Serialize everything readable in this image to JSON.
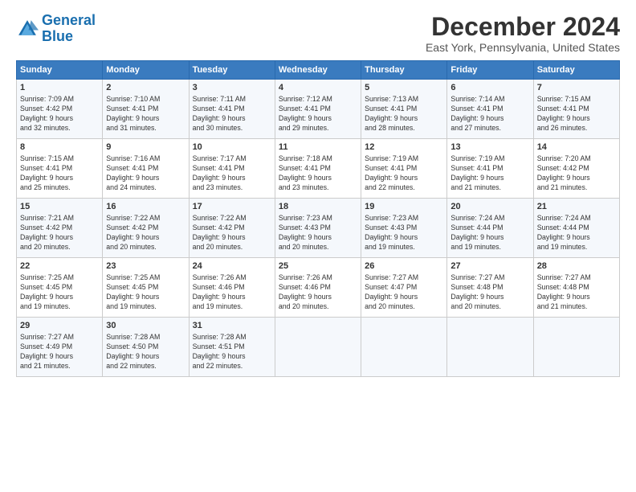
{
  "header": {
    "logo_line1": "General",
    "logo_line2": "Blue",
    "main_title": "December 2024",
    "subtitle": "East York, Pennsylvania, United States"
  },
  "columns": [
    "Sunday",
    "Monday",
    "Tuesday",
    "Wednesday",
    "Thursday",
    "Friday",
    "Saturday"
  ],
  "weeks": [
    [
      {
        "day": "1",
        "info": "Sunrise: 7:09 AM\nSunset: 4:42 PM\nDaylight: 9 hours\nand 32 minutes."
      },
      {
        "day": "2",
        "info": "Sunrise: 7:10 AM\nSunset: 4:41 PM\nDaylight: 9 hours\nand 31 minutes."
      },
      {
        "day": "3",
        "info": "Sunrise: 7:11 AM\nSunset: 4:41 PM\nDaylight: 9 hours\nand 30 minutes."
      },
      {
        "day": "4",
        "info": "Sunrise: 7:12 AM\nSunset: 4:41 PM\nDaylight: 9 hours\nand 29 minutes."
      },
      {
        "day": "5",
        "info": "Sunrise: 7:13 AM\nSunset: 4:41 PM\nDaylight: 9 hours\nand 28 minutes."
      },
      {
        "day": "6",
        "info": "Sunrise: 7:14 AM\nSunset: 4:41 PM\nDaylight: 9 hours\nand 27 minutes."
      },
      {
        "day": "7",
        "info": "Sunrise: 7:15 AM\nSunset: 4:41 PM\nDaylight: 9 hours\nand 26 minutes."
      }
    ],
    [
      {
        "day": "8",
        "info": "Sunrise: 7:15 AM\nSunset: 4:41 PM\nDaylight: 9 hours\nand 25 minutes."
      },
      {
        "day": "9",
        "info": "Sunrise: 7:16 AM\nSunset: 4:41 PM\nDaylight: 9 hours\nand 24 minutes."
      },
      {
        "day": "10",
        "info": "Sunrise: 7:17 AM\nSunset: 4:41 PM\nDaylight: 9 hours\nand 23 minutes."
      },
      {
        "day": "11",
        "info": "Sunrise: 7:18 AM\nSunset: 4:41 PM\nDaylight: 9 hours\nand 23 minutes."
      },
      {
        "day": "12",
        "info": "Sunrise: 7:19 AM\nSunset: 4:41 PM\nDaylight: 9 hours\nand 22 minutes."
      },
      {
        "day": "13",
        "info": "Sunrise: 7:19 AM\nSunset: 4:41 PM\nDaylight: 9 hours\nand 21 minutes."
      },
      {
        "day": "14",
        "info": "Sunrise: 7:20 AM\nSunset: 4:42 PM\nDaylight: 9 hours\nand 21 minutes."
      }
    ],
    [
      {
        "day": "15",
        "info": "Sunrise: 7:21 AM\nSunset: 4:42 PM\nDaylight: 9 hours\nand 20 minutes."
      },
      {
        "day": "16",
        "info": "Sunrise: 7:22 AM\nSunset: 4:42 PM\nDaylight: 9 hours\nand 20 minutes."
      },
      {
        "day": "17",
        "info": "Sunrise: 7:22 AM\nSunset: 4:42 PM\nDaylight: 9 hours\nand 20 minutes."
      },
      {
        "day": "18",
        "info": "Sunrise: 7:23 AM\nSunset: 4:43 PM\nDaylight: 9 hours\nand 20 minutes."
      },
      {
        "day": "19",
        "info": "Sunrise: 7:23 AM\nSunset: 4:43 PM\nDaylight: 9 hours\nand 19 minutes."
      },
      {
        "day": "20",
        "info": "Sunrise: 7:24 AM\nSunset: 4:44 PM\nDaylight: 9 hours\nand 19 minutes."
      },
      {
        "day": "21",
        "info": "Sunrise: 7:24 AM\nSunset: 4:44 PM\nDaylight: 9 hours\nand 19 minutes."
      }
    ],
    [
      {
        "day": "22",
        "info": "Sunrise: 7:25 AM\nSunset: 4:45 PM\nDaylight: 9 hours\nand 19 minutes."
      },
      {
        "day": "23",
        "info": "Sunrise: 7:25 AM\nSunset: 4:45 PM\nDaylight: 9 hours\nand 19 minutes."
      },
      {
        "day": "24",
        "info": "Sunrise: 7:26 AM\nSunset: 4:46 PM\nDaylight: 9 hours\nand 19 minutes."
      },
      {
        "day": "25",
        "info": "Sunrise: 7:26 AM\nSunset: 4:46 PM\nDaylight: 9 hours\nand 20 minutes."
      },
      {
        "day": "26",
        "info": "Sunrise: 7:27 AM\nSunset: 4:47 PM\nDaylight: 9 hours\nand 20 minutes."
      },
      {
        "day": "27",
        "info": "Sunrise: 7:27 AM\nSunset: 4:48 PM\nDaylight: 9 hours\nand 20 minutes."
      },
      {
        "day": "28",
        "info": "Sunrise: 7:27 AM\nSunset: 4:48 PM\nDaylight: 9 hours\nand 21 minutes."
      }
    ],
    [
      {
        "day": "29",
        "info": "Sunrise: 7:27 AM\nSunset: 4:49 PM\nDaylight: 9 hours\nand 21 minutes."
      },
      {
        "day": "30",
        "info": "Sunrise: 7:28 AM\nSunset: 4:50 PM\nDaylight: 9 hours\nand 22 minutes."
      },
      {
        "day": "31",
        "info": "Sunrise: 7:28 AM\nSunset: 4:51 PM\nDaylight: 9 hours\nand 22 minutes."
      },
      {
        "day": "",
        "info": ""
      },
      {
        "day": "",
        "info": ""
      },
      {
        "day": "",
        "info": ""
      },
      {
        "day": "",
        "info": ""
      }
    ]
  ]
}
